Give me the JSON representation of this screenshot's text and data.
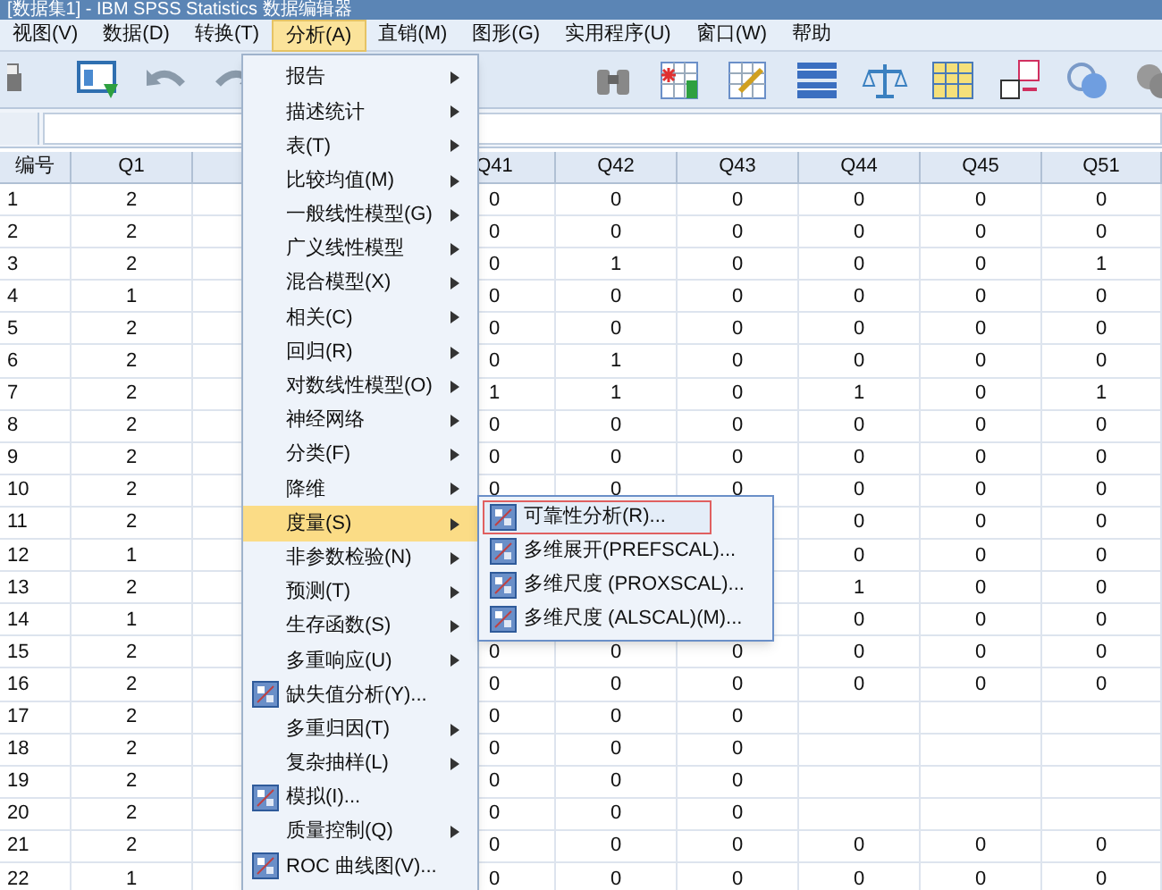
{
  "window": {
    "title": "[数据集1] - IBM SPSS Statistics 数据编辑器"
  },
  "menubar": [
    {
      "label": "视图(V)",
      "selected": false
    },
    {
      "label": "数据(D)",
      "selected": false
    },
    {
      "label": "转换(T)",
      "selected": false
    },
    {
      "label": "分析(A)",
      "selected": true
    },
    {
      "label": "直销(M)",
      "selected": false
    },
    {
      "label": "图形(G)",
      "selected": false
    },
    {
      "label": "实用程序(U)",
      "selected": false
    },
    {
      "label": "窗口(W)",
      "selected": false
    },
    {
      "label": "帮助",
      "selected": false
    }
  ],
  "table": {
    "columns": [
      "编号",
      "Q1",
      null,
      null,
      "Q41",
      "Q42",
      "Q43",
      "Q44",
      "Q45",
      "Q51"
    ],
    "rows": [
      [
        "1",
        "2",
        null,
        null,
        "0",
        "0",
        "0",
        "0",
        "0",
        "0"
      ],
      [
        "2",
        "2",
        null,
        null,
        "0",
        "0",
        "0",
        "0",
        "0",
        "0"
      ],
      [
        "3",
        "2",
        null,
        null,
        "0",
        "1",
        "0",
        "0",
        "0",
        "1"
      ],
      [
        "4",
        "1",
        null,
        null,
        "0",
        "0",
        "0",
        "0",
        "0",
        "0"
      ],
      [
        "5",
        "2",
        null,
        null,
        "0",
        "0",
        "0",
        "0",
        "0",
        "0"
      ],
      [
        "6",
        "2",
        null,
        null,
        "0",
        "1",
        "0",
        "0",
        "0",
        "0"
      ],
      [
        "7",
        "2",
        null,
        null,
        "1",
        "1",
        "0",
        "1",
        "0",
        "1"
      ],
      [
        "8",
        "2",
        null,
        null,
        "0",
        "0",
        "0",
        "0",
        "0",
        "0"
      ],
      [
        "9",
        "2",
        null,
        null,
        "0",
        "0",
        "0",
        "0",
        "0",
        "0"
      ],
      [
        "10",
        "2",
        null,
        null,
        "0",
        "0",
        "0",
        "0",
        "0",
        "0"
      ],
      [
        "11",
        "2",
        null,
        null,
        null,
        null,
        null,
        "0",
        "0",
        "0"
      ],
      [
        "12",
        "1",
        null,
        null,
        null,
        null,
        null,
        "0",
        "0",
        "0"
      ],
      [
        "13",
        "2",
        null,
        null,
        null,
        null,
        null,
        "1",
        "0",
        "0"
      ],
      [
        "14",
        "1",
        null,
        null,
        null,
        null,
        null,
        "0",
        "0",
        "0"
      ],
      [
        "15",
        "2",
        null,
        null,
        "0",
        "0",
        "0",
        "0",
        "0",
        "0"
      ],
      [
        "16",
        "2",
        null,
        null,
        "0",
        "0",
        "0",
        "0",
        "0",
        "0"
      ],
      [
        "17",
        "2",
        null,
        null,
        "0",
        "0",
        "0",
        null,
        null,
        null
      ],
      [
        "18",
        "2",
        null,
        null,
        "0",
        "0",
        "0",
        null,
        null,
        null
      ],
      [
        "19",
        "2",
        null,
        null,
        "0",
        "0",
        "0",
        null,
        null,
        null
      ],
      [
        "20",
        "2",
        null,
        null,
        "0",
        "0",
        "0",
        null,
        null,
        null
      ],
      [
        "21",
        "2",
        null,
        null,
        "0",
        "0",
        "0",
        "0",
        "0",
        "0"
      ],
      [
        "22",
        "1",
        null,
        null,
        "0",
        "0",
        "0",
        "0",
        "0",
        "0"
      ]
    ]
  },
  "analyze_menu": [
    {
      "label": "报告",
      "kind": "submenu",
      "selected": false
    },
    {
      "label": "描述统计",
      "kind": "submenu",
      "selected": false
    },
    {
      "label": "表(T)",
      "kind": "submenu",
      "selected": false
    },
    {
      "label": "比较均值(M)",
      "kind": "submenu",
      "selected": false
    },
    {
      "label": "一般线性模型(G)",
      "kind": "submenu",
      "selected": false
    },
    {
      "label": "广义线性模型",
      "kind": "submenu",
      "selected": false
    },
    {
      "label": "混合模型(X)",
      "kind": "submenu",
      "selected": false
    },
    {
      "label": "相关(C)",
      "kind": "submenu",
      "selected": false
    },
    {
      "label": "回归(R)",
      "kind": "submenu",
      "selected": false
    },
    {
      "label": "对数线性模型(O)",
      "kind": "submenu",
      "selected": false
    },
    {
      "label": "神经网络",
      "kind": "submenu",
      "selected": false
    },
    {
      "label": "分类(F)",
      "kind": "submenu",
      "selected": false
    },
    {
      "label": "降维",
      "kind": "submenu",
      "selected": false
    },
    {
      "label": "度量(S)",
      "kind": "submenu",
      "selected": true
    },
    {
      "label": "非参数检验(N)",
      "kind": "submenu",
      "selected": false
    },
    {
      "label": "预测(T)",
      "kind": "submenu",
      "selected": false
    },
    {
      "label": "生存函数(S)",
      "kind": "submenu",
      "selected": false
    },
    {
      "label": "多重响应(U)",
      "kind": "submenu",
      "selected": false
    },
    {
      "label": "缺失值分析(Y)...",
      "kind": "action",
      "selected": false
    },
    {
      "label": "多重归因(T)",
      "kind": "submenu",
      "selected": false
    },
    {
      "label": "复杂抽样(L)",
      "kind": "submenu",
      "selected": false
    },
    {
      "label": "模拟(I)...",
      "kind": "action",
      "selected": false
    },
    {
      "label": "质量控制(Q)",
      "kind": "submenu",
      "selected": false
    },
    {
      "label": "ROC 曲线图(V)...",
      "kind": "action",
      "selected": false
    }
  ],
  "scale_submenu": [
    {
      "label": "可靠性分析(R)...",
      "selected": true
    },
    {
      "label": "多维展开(PREFSCAL)...",
      "selected": false
    },
    {
      "label": "多维尺度 (PROXSCAL)...",
      "selected": false
    },
    {
      "label": "多维尺度 (ALSCAL)(M)...",
      "selected": false
    }
  ]
}
